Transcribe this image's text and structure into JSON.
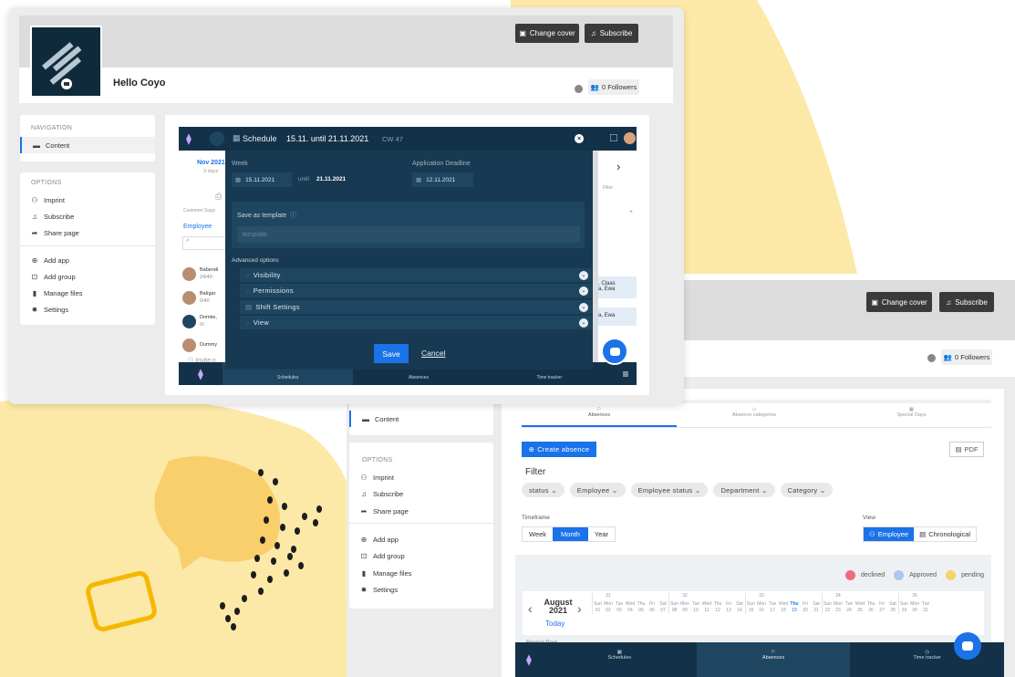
{
  "colors": {
    "yellow_blob": "#fce9a8",
    "accent_yellow": "#f7c33b",
    "navy": "#133249",
    "modal_bg": "#173a52",
    "primary_blue": "#1a73e8",
    "dark_btn": "#3a3a3a"
  },
  "front": {
    "header": {
      "change_cover": "Change cover",
      "subscribe": "Subscribe",
      "title": "Hello Coyo",
      "followers": "0 Followers"
    },
    "nav": {
      "heading": "NAVIGATION",
      "content": "Content"
    },
    "options": {
      "heading": "OPTIONS",
      "imprint": "Imprint",
      "subscribe": "Subscribe",
      "share": "Share page",
      "add_app": "Add app",
      "add_group": "Add group",
      "manage_files": "Manage files",
      "settings": "Settings"
    },
    "schedule": {
      "title": "Schedule",
      "range": "15.11. until 21.11.2021",
      "cw": "CW 47",
      "left_month": "Nov 2021",
      "left_days": "3 days",
      "customer_supp": "Customer Supp",
      "employee_header": "Employee",
      "employees": [
        {
          "name": "Babendi",
          "count": "24/40"
        },
        {
          "name": "Balígar",
          "count": "0/40"
        },
        {
          "name": "Domke,",
          "count": "0/-"
        },
        {
          "name": "Dummy",
          "count": ""
        }
      ],
      "invite": "Invite n",
      "right_filter": "Filter",
      "right_claas": ", Claas",
      "right_ewa1": "a, Ewa",
      "right_ewa2": "a, Ewa",
      "bottom_nav": [
        "Schedules",
        "Absences",
        "Time tracker"
      ]
    },
    "modal": {
      "week_label": "Week",
      "week_value": "15.11.2021",
      "until": "until",
      "until_value": "21.11.2021",
      "deadline_label": "Application Deadline",
      "deadline_value": "12.11.2021",
      "template_label": "Save as template",
      "template_placeholder": "template",
      "advanced": "Advanced options",
      "sections": [
        "Visibility",
        "Permissions",
        "Shift Settings",
        "View"
      ],
      "save": "Save",
      "cancel": "Cancel"
    }
  },
  "back": {
    "header": {
      "change_cover": "Change cover",
      "subscribe": "Subscribe",
      "followers": "0 Followers"
    },
    "nav": {
      "content": "Content"
    },
    "options": {
      "heading": "OPTIONS",
      "imprint": "Imprint",
      "subscribe": "Subscribe",
      "share": "Share page",
      "add_app": "Add app",
      "add_group": "Add group",
      "manage_files": "Manage files",
      "settings": "Settings"
    },
    "tabs": [
      "Absences",
      "Absence categories",
      "Special Days"
    ],
    "create_absence": "Create absence",
    "pdf": "PDF",
    "filter_heading": "Filter",
    "filters": [
      "status",
      "Employee",
      "Employee status",
      "Department",
      "Category"
    ],
    "timeframe_label": "Timeframe",
    "timeframe": [
      "Week",
      "Month",
      "Year"
    ],
    "view_label": "View",
    "view": [
      "Employee",
      "Chronological"
    ],
    "legend": [
      {
        "label": "declined",
        "color": "#f06b7c"
      },
      {
        "label": "Approved",
        "color": "#a9c8ea"
      },
      {
        "label": "pending",
        "color": "#f6d365"
      }
    ],
    "calendar": {
      "month": "August",
      "year": "2021",
      "today": "Today",
      "weeks": [
        "31",
        "32",
        "33",
        "34",
        "35"
      ],
      "dows": [
        "Sun",
        "Mon",
        "Tue",
        "Wed",
        "Thu",
        "Fri",
        "Sat",
        "Sun",
        "Mon",
        "Tue",
        "Wed",
        "Thu",
        "Fri",
        "Sat",
        "Sun",
        "Mon",
        "Tue",
        "Wed",
        "Thu",
        "Fri",
        "Sat",
        "Sun",
        "Mon",
        "Tue",
        "Wed",
        "Thu",
        "Fri",
        "Sat",
        "Sun",
        "Mon",
        "Tue"
      ],
      "days": [
        "01",
        "02",
        "03",
        "04",
        "05",
        "06",
        "07",
        "08",
        "09",
        "10",
        "11",
        "12",
        "13",
        "14",
        "15",
        "16",
        "17",
        "18",
        "19",
        "20",
        "21",
        "22",
        "23",
        "24",
        "25",
        "26",
        "27",
        "28",
        "29",
        "30",
        "31"
      ],
      "special_days": "Special Days"
    },
    "bottom_nav": [
      "Schedules",
      "Absences",
      "Time tracker"
    ]
  }
}
